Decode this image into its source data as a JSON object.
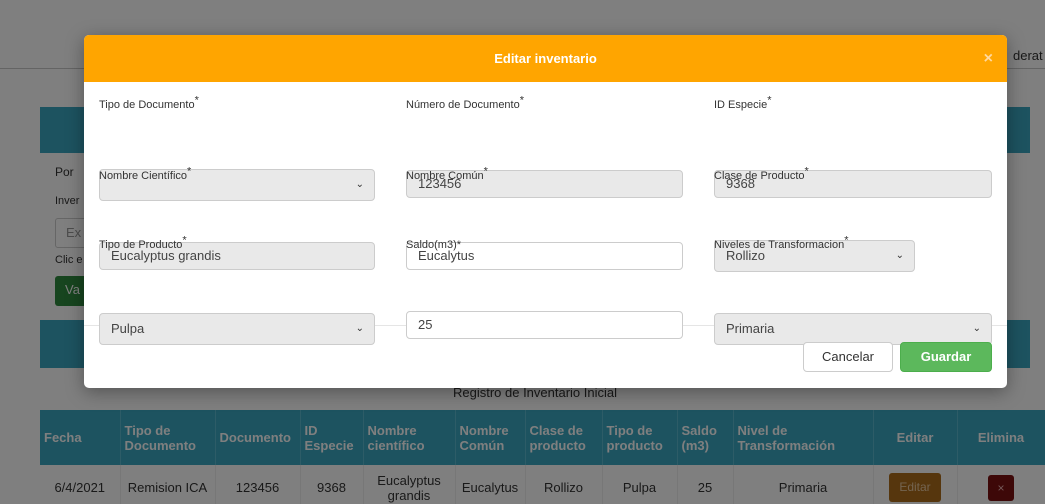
{
  "background": {
    "top_right_text": "derat",
    "left_labels": [
      "Por",
      "Inver",
      "Clic e"
    ],
    "left_input_text": "Ex",
    "left_button_text": "Va",
    "table_caption": "Registro de Inventario Inicial",
    "table": {
      "headers": [
        "Fecha",
        "Tipo de Documento",
        "Documento",
        "ID Especie",
        "Nombre científico",
        "Nombre Común",
        "Clase de producto",
        "Tipo de producto",
        "Saldo (m3)",
        "Nivel de Transformación",
        "Editar",
        "Elimina"
      ],
      "rows": [
        {
          "fecha": "6/4/2021",
          "tipo_documento": "Remision ICA",
          "documento": "123456",
          "id_especie": "9368",
          "nombre_cientifico": "Eucalyptus grandis",
          "nombre_comun": "Eucalytus",
          "clase_producto": "Rollizo",
          "tipo_producto": "Pulpa",
          "saldo": "25",
          "nivel_transformacion": "Primaria",
          "editar_label": "Editar",
          "eliminar_label": "×"
        }
      ]
    }
  },
  "modal": {
    "title": "Editar inventario",
    "close_label": "×",
    "fields": {
      "tipo_documento": {
        "label": "Tipo de Documento",
        "value": ""
      },
      "numero_documento": {
        "label": "Número de Documento",
        "value": "123456"
      },
      "id_especie": {
        "label": "ID Especie",
        "value": "9368"
      },
      "nombre_cientifico": {
        "label": "Nombre Científico",
        "value": "Eucalyptus grandis"
      },
      "nombre_comun": {
        "label": "Nombre Común",
        "value": "Eucalytus"
      },
      "clase_producto": {
        "label": "Clase de Producto",
        "value": "Rollizo"
      },
      "tipo_producto": {
        "label": "Tipo de Producto",
        "value": "Pulpa"
      },
      "saldo": {
        "label": "Saldo(m3)*",
        "value": "25"
      },
      "niveles_transformacion": {
        "label": "Niveles de Transformacion",
        "value": "Primaria"
      }
    },
    "required_mark": "*",
    "chevron": "⌄",
    "cancel_label": "Cancelar",
    "save_label": "Guardar"
  },
  "colors": {
    "modal_header": "#ffa500",
    "table_header": "#3aa7c1",
    "save_button": "#5cb85c"
  }
}
